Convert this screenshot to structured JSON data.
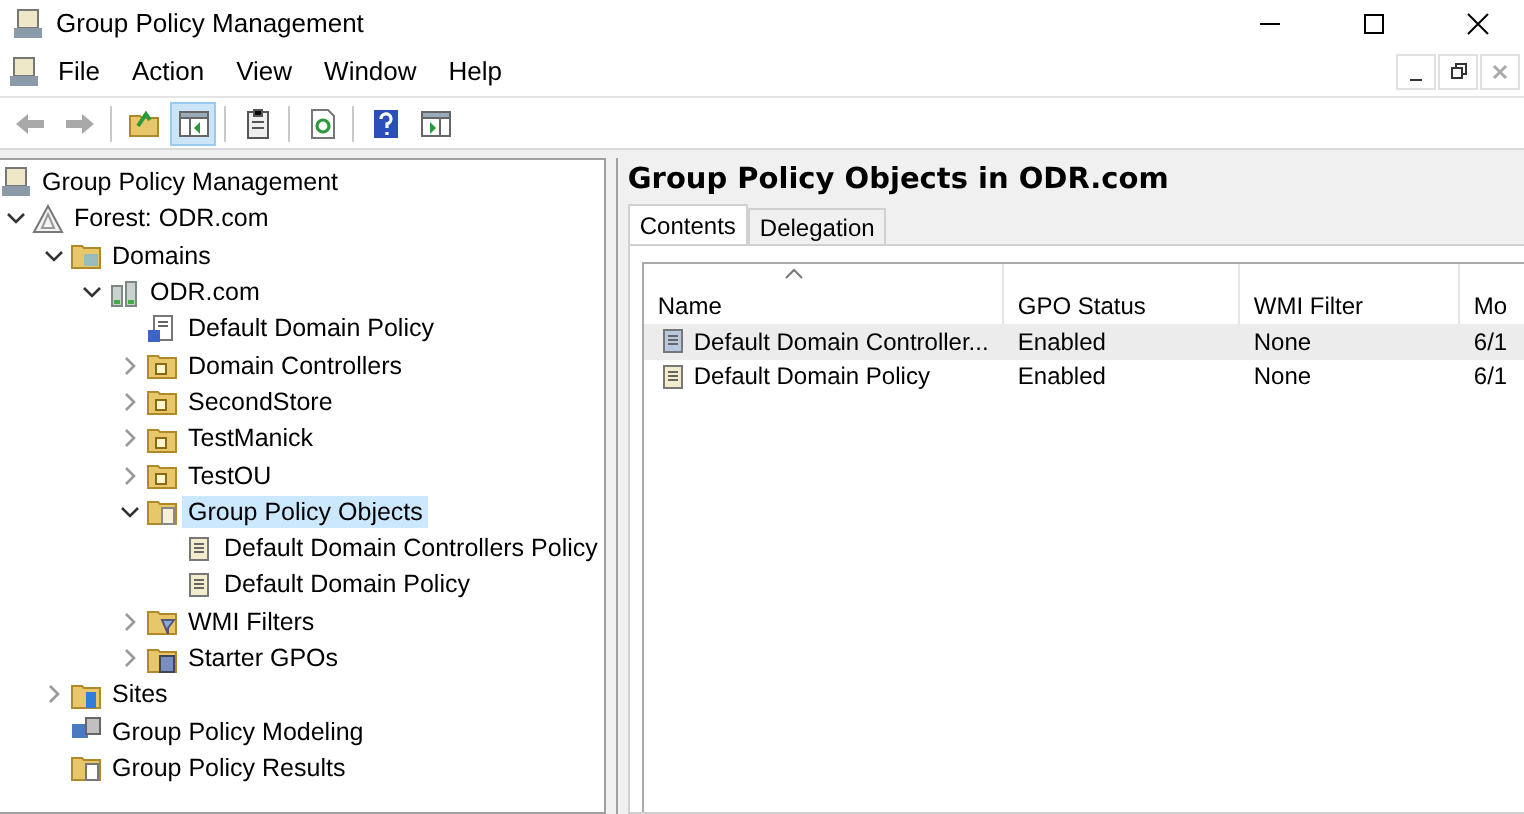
{
  "window": {
    "title": "Group Policy Management"
  },
  "menu": [
    "File",
    "Action",
    "View",
    "Window",
    "Help"
  ],
  "toolbar": [
    {
      "kind": "back",
      "disabled": true
    },
    {
      "kind": "forward",
      "disabled": true
    },
    {
      "kind": "sep"
    },
    {
      "kind": "up"
    },
    {
      "kind": "pane",
      "selected": true
    },
    {
      "kind": "sep"
    },
    {
      "kind": "clipboard"
    },
    {
      "kind": "sep"
    },
    {
      "kind": "refresh"
    },
    {
      "kind": "sep"
    },
    {
      "kind": "help"
    },
    {
      "kind": "action-pane"
    }
  ],
  "tree": {
    "label": "Group Policy Management",
    "kind": "console",
    "selected": false,
    "children": [
      {
        "label": "Forest: ODR.com",
        "kind": "forest",
        "expanded": true,
        "selected": false,
        "children": [
          {
            "label": "Domains",
            "kind": "domains",
            "expanded": true,
            "selected": false,
            "children": [
              {
                "label": "ODR.com",
                "kind": "domain",
                "expanded": true,
                "selected": false,
                "children": [
                  {
                    "label": "Default Domain Policy",
                    "kind": "gpo-link",
                    "selected": false
                  },
                  {
                    "label": "Domain Controllers",
                    "kind": "ou",
                    "expanded": false,
                    "selected": false
                  },
                  {
                    "label": "SecondStore",
                    "kind": "ou",
                    "expanded": false,
                    "selected": false
                  },
                  {
                    "label": "TestManick",
                    "kind": "ou",
                    "expanded": false,
                    "selected": false
                  },
                  {
                    "label": "TestOU",
                    "kind": "ou",
                    "expanded": false,
                    "selected": false
                  },
                  {
                    "label": "Group Policy Objects",
                    "kind": "gpo-folder",
                    "expanded": true,
                    "selected": true,
                    "children": [
                      {
                        "label": "Default Domain Controllers Policy",
                        "kind": "gpo",
                        "selected": false
                      },
                      {
                        "label": "Default Domain Policy",
                        "kind": "gpo",
                        "selected": false
                      }
                    ]
                  },
                  {
                    "label": "WMI Filters",
                    "kind": "wmi",
                    "expanded": false,
                    "selected": false
                  },
                  {
                    "label": "Starter GPOs",
                    "kind": "starter",
                    "expanded": false,
                    "selected": false
                  }
                ]
              }
            ]
          },
          {
            "label": "Sites",
            "kind": "sites",
            "expanded": false,
            "selected": false
          },
          {
            "label": "Group Policy Modeling",
            "kind": "modeling",
            "selected": false
          },
          {
            "label": "Group Policy Results",
            "kind": "results",
            "selected": false
          }
        ]
      }
    ]
  },
  "details": {
    "heading": "Group Policy Objects in ODR.com",
    "tabs": [
      {
        "label": "Contents",
        "selected": true
      },
      {
        "label": "Delegation",
        "selected": false
      }
    ],
    "columns": [
      {
        "label": "Name",
        "sorted": true
      },
      {
        "label": "GPO Status",
        "sorted": false
      },
      {
        "label": "WMI Filter",
        "sorted": false
      },
      {
        "label": "Mo",
        "sorted": false
      }
    ],
    "rows": [
      {
        "selected": true,
        "cells": [
          "Default Domain Controller...",
          "Enabled",
          "None",
          "6/1"
        ]
      },
      {
        "selected": false,
        "cells": [
          "Default Domain Policy",
          "Enabled",
          "None",
          "6/1"
        ]
      }
    ]
  }
}
